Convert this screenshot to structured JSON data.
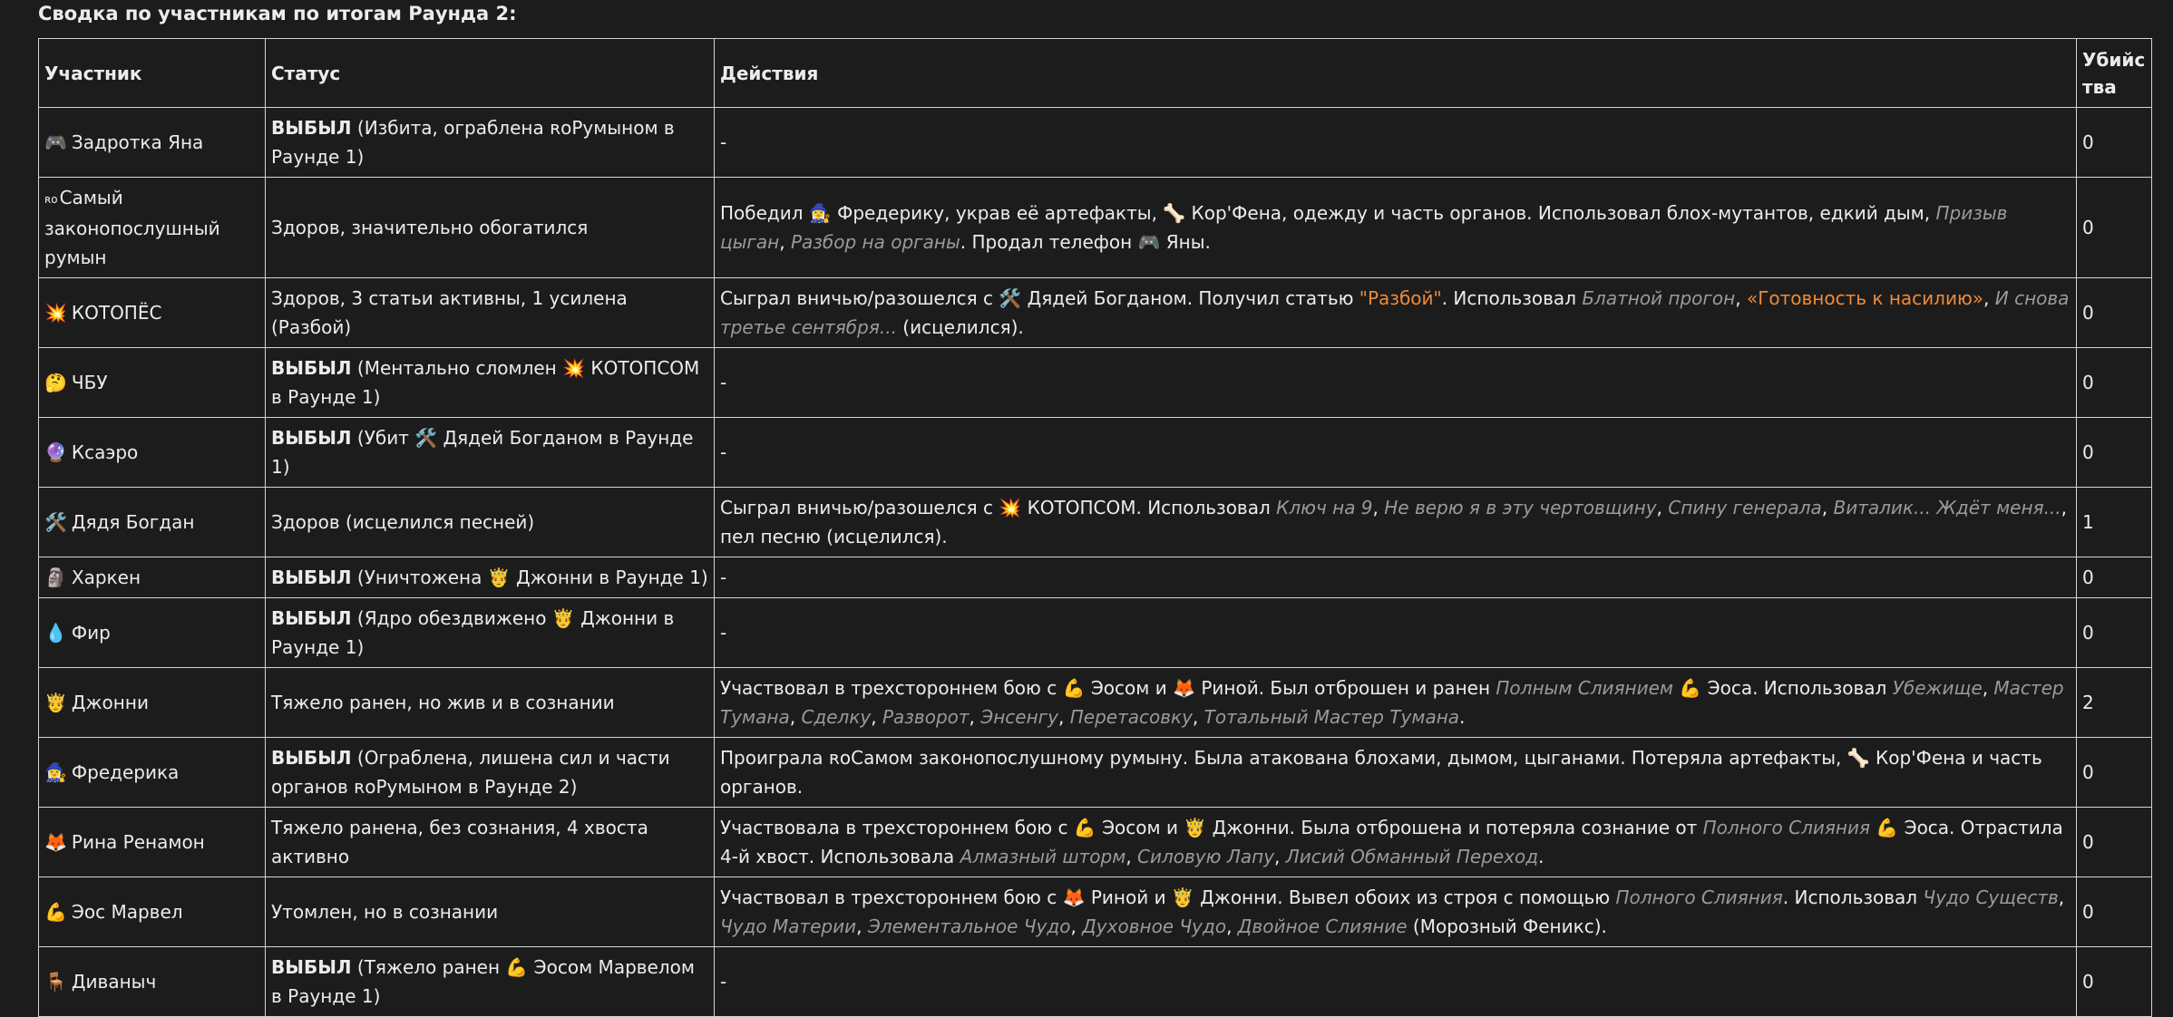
{
  "heading": "Сводка по участникам по итогам Раунда 2:",
  "table": {
    "headers": [
      "Участник",
      "Статус",
      "Действия",
      "Убийства"
    ],
    "rows": [
      {
        "icon": "🎮",
        "name": "Задротка Яна",
        "status_bold": "ВЫБЫЛ",
        "status": " (Избита, ограблена ʀᴏРумыном в Раунде 1)",
        "actions": "-",
        "kills": "0"
      },
      {
        "icon": "ʀᴏ",
        "name": "Самый законопослушный румын",
        "status_bold": "",
        "status": "Здоров, значительно обогатился",
        "actions": "",
        "kills": "0"
      },
      {
        "icon": "💥",
        "name": "КОТОПЁС",
        "status_bold": "",
        "status": "Здоров, 3 статьи активны, 1 усилена (Разбой)",
        "actions": "",
        "kills": "0"
      },
      {
        "icon": "🤔",
        "name": "ЧБУ",
        "status_bold": "ВЫБЫЛ",
        "status": " (Ментально сломлен 💥 КОТОПСОМ в Раунде 1)",
        "actions": "-",
        "kills": "0"
      },
      {
        "icon": "🔮",
        "name": "Ксаэро",
        "status_bold": "ВЫБЫЛ",
        "status": " (Убит 🛠️ Дядей Богданом в Раунде 1)",
        "actions": "-",
        "kills": "0"
      },
      {
        "icon": "🛠️",
        "name": "Дядя Богдан",
        "status_bold": "",
        "status": "Здоров (исцелился песней)",
        "actions": "",
        "kills": "1"
      },
      {
        "icon": "🗿",
        "name": "Харкен",
        "status_bold": "ВЫБЫЛ",
        "status": " (Уничтожена 🤴 Джонни в Раунде 1)",
        "actions": "-",
        "kills": "0"
      },
      {
        "icon": "💧",
        "name": "Фир",
        "status_bold": "ВЫБЫЛ",
        "status": " (Ядро обездвижено 🤴 Джонни в Раунде 1)",
        "actions": "-",
        "kills": "0"
      },
      {
        "icon": "🤴",
        "name": "Джонни",
        "status_bold": "",
        "status": "Тяжело ранен, но жив и в сознании",
        "actions": "",
        "kills": "2"
      },
      {
        "icon": "🧙‍♀️",
        "name": "Фредерика",
        "status_bold": "ВЫБЫЛ",
        "status": " (Ограблена, лишена сил и части органов ʀᴏРумыном в Раунде 2)",
        "actions": "",
        "kills": "0"
      },
      {
        "icon": "🦊",
        "name": "Рина Ренамон",
        "status_bold": "",
        "status": "Тяжело ранена, без сознания, 4 хвоста активно",
        "actions": "",
        "kills": "0"
      },
      {
        "icon": "💪",
        "name": "Эос Марвел",
        "status_bold": "",
        "status": "Утомлен, но в сознании",
        "actions": "",
        "kills": "0"
      },
      {
        "icon": "🪑",
        "name": "Диваныч",
        "status_bold": "ВЫБЫЛ",
        "status": " (Тяжело ранен 💪 Эосом Марвелом в Раунде 1)",
        "actions": "-",
        "kills": "0"
      }
    ],
    "rich_actions": {
      "r1": {
        "t1": "Победил 🧙‍♀️ Фредерику, украв её артефакты, 🦴 Кор'Фена, одежду и часть органов. Использовал блох-мутантов, едкий дым, ",
        "i1": "Призыв цыган",
        "t2": ", ",
        "i2": "Разбор на органы",
        "t3": ". Продал телефон 🎮 Яны."
      },
      "r2": {
        "t1": "Сыграл вничью/разошелся с 🛠️ Дядей Богданом. Получил статью ",
        "o1": "\"Разбой\"",
        "t2": ". Использовал ",
        "i1": "Блатной прогон",
        "t3": ", ",
        "o2": "«Готовность к насилию»",
        "t4": ", ",
        "i2": "И снова третье сентября...",
        "t5": " (исцелился)."
      },
      "r5": {
        "t1": "Сыграл вничью/разошелся с 💥 КОТОПСОМ. Использовал ",
        "i1": "Ключ на 9",
        "t2": ", ",
        "i2": "Не верю я в эту чертовщину",
        "t3": ", ",
        "i3": "Спину генерала",
        "t4": ", ",
        "i4": "Виталик... Ждёт меня...",
        "t5": ", пел песню (исцелился)."
      },
      "r8": {
        "t1": "Участвовал в трехстороннем бою с 💪 Эосом и 🦊 Риной. Был отброшен и ранен ",
        "i1": "Полным Слиянием",
        "t2": " 💪 Эоса. Использовал ",
        "i2": "Убежище",
        "t3": ", ",
        "i3": "Мастер Тумана",
        "t4": ", ",
        "i4": "Сделку",
        "t5": ", ",
        "i5": "Разворот",
        "t6": ", ",
        "i6": "Энсенгу",
        "t7": ", ",
        "i7": "Перетасовку",
        "t8": ", ",
        "i8": "Тотальный Мастер Тумана",
        "t9": "."
      },
      "r9": {
        "t1": "Проиграла ʀᴏСамом законопослушному румыну. Была атакована блохами, дымом, цыганами. Потеряла артефакты, 🦴 Кор'Фена и часть органов."
      },
      "r10": {
        "t1": "Участвовала в трехстороннем бою с 💪 Эосом и 🤴 Джонни. Была отброшена и потеряла сознание от ",
        "i1": "Полного Слияния",
        "t2": " 💪 Эоса. Отрастила 4-й хвост. Использовала ",
        "i2": "Алмазный шторм",
        "t3": ", ",
        "i3": "Силовую Лапу",
        "t4": ", ",
        "i4": "Лисий Обманный Переход",
        "t5": "."
      },
      "r11": {
        "t1": "Участвовал в трехстороннем бою с 🦊 Риной и 🤴 Джонни. Вывел обоих из строя с помощью ",
        "i1": "Полного Слияния",
        "t2": ". Использовал ",
        "i2": "Чудо Существ",
        "t3": ", ",
        "i3": "Чудо Материи",
        "t4": ", ",
        "i4": "Элементальное Чудо",
        "t5": ", ",
        "i5": "Духовное Чудо",
        "t6": ", ",
        "i6": "Двойное Слияние",
        "t7": " (Морозный Феникс)."
      }
    }
  }
}
